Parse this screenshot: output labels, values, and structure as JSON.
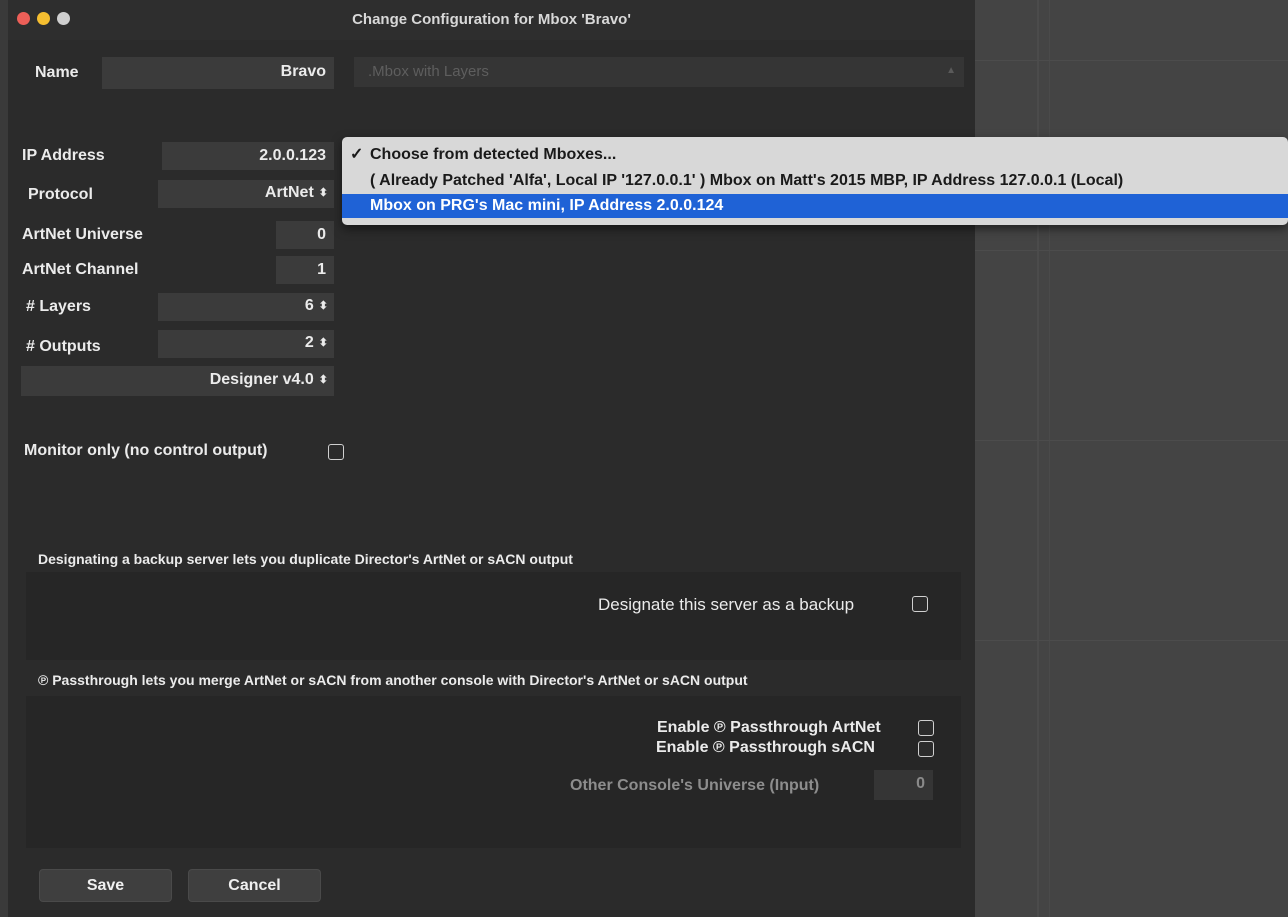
{
  "window": {
    "title": "Change Configuration for Mbox 'Bravo'"
  },
  "form": {
    "name_label": "Name",
    "name_value": "Bravo",
    "type_select": ".Mbox with Layers",
    "ip_label": "IP Address",
    "ip_value": "2.0.0.123",
    "protocol_label": "Protocol",
    "protocol_value": "ArtNet",
    "universe_label": "ArtNet Universe",
    "universe_value": "0",
    "channel_label": "ArtNet Channel",
    "channel_value": "1",
    "layers_label": "# Layers",
    "layers_value": "6",
    "outputs_label": "# Outputs",
    "outputs_value": "2",
    "version_value": "Designer v4.0",
    "monitor_label": "Monitor only (no control output)"
  },
  "dropdown": {
    "items": [
      {
        "check": "✓",
        "label": "Choose from detected Mboxes..."
      },
      {
        "check": "",
        "label": "( Already Patched 'Alfa', Local IP '127.0.0.1' ) Mbox on Matt's 2015 MBP, IP Address 127.0.0.1 (Local)"
      },
      {
        "check": "",
        "label": "Mbox on PRG's Mac mini, IP Address 2.0.0.124"
      }
    ],
    "selected_color": "#1f62d6"
  },
  "backup": {
    "description": "Designating a backup server lets you duplicate Director's ArtNet or sACN output",
    "checkbox_label": "Designate this server as a backup"
  },
  "passthrough": {
    "description": "℗ Passthrough lets you merge ArtNet or sACN from another console with Director's ArtNet or sACN output",
    "artnet_label": "Enable ℗ Passthrough ArtNet",
    "sacn_label": "Enable ℗ Passthrough sACN",
    "universe_label": "Other Console's Universe (Input)",
    "universe_value": "0"
  },
  "buttons": {
    "save": "Save",
    "cancel": "Cancel"
  },
  "colors": {
    "close": "#ec5f58",
    "minimize": "#f5be30",
    "zoom": "#cfcfcf"
  },
  "icons": {
    "stepper": "up-down-arrows-icon",
    "check": "checkmark-icon"
  }
}
